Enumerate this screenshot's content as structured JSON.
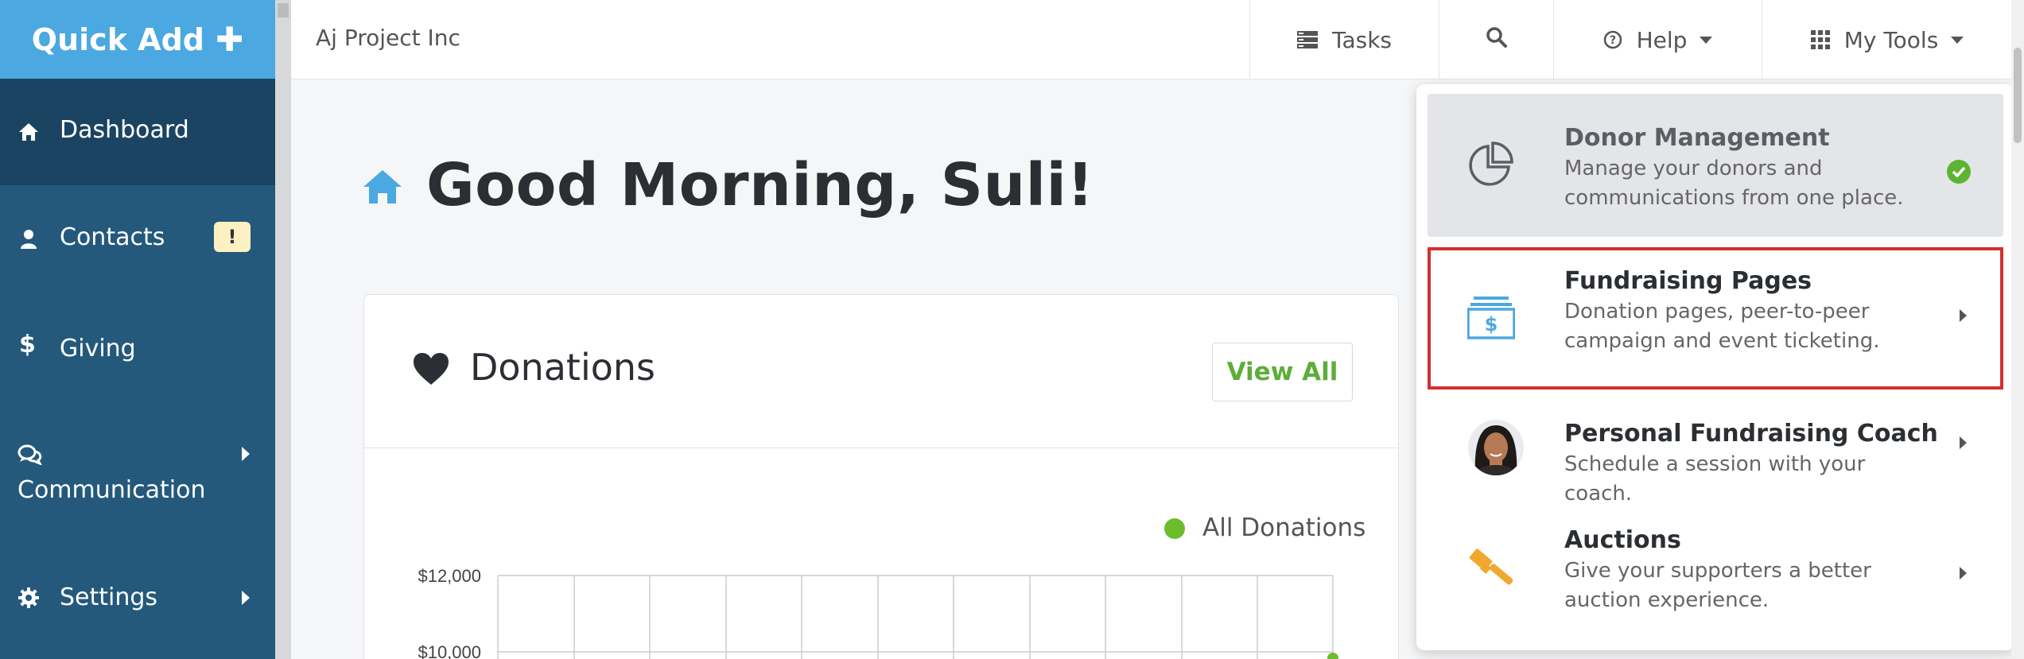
{
  "sidebar": {
    "quick_add": "Quick Add",
    "items": [
      {
        "label": "Dashboard",
        "icon": "home-icon"
      },
      {
        "label": "Contacts",
        "icon": "user-icon",
        "badge": "!"
      },
      {
        "label": "Giving",
        "icon": "dollar-icon"
      },
      {
        "label": "Communication",
        "icon": "chat-icon"
      },
      {
        "label": "Settings",
        "icon": "gear-icon"
      }
    ]
  },
  "topbar": {
    "org_name": "Aj Project Inc",
    "tasks_label": "Tasks",
    "help_label": "Help",
    "tools_label": "My Tools"
  },
  "main": {
    "greeting": "Good Morning, Suli!",
    "donations_card": {
      "title": "Donations",
      "view_all_label": "View All",
      "legend_label": "All Donations",
      "y_ticks": [
        "$12,000",
        "$10,000"
      ]
    }
  },
  "tools_menu": {
    "items": [
      {
        "title": "Donor Management",
        "desc": "Manage your donors and communications from one place.",
        "icon": "pie-chart-icon",
        "active": true
      },
      {
        "title": "Fundraising Pages",
        "desc": "Donation pages, peer-to-peer campaign and event ticketing.",
        "icon": "money-stack-icon",
        "highlighted": true
      },
      {
        "title": "Personal Fundraising Coach",
        "desc": "Schedule a session with your coach.",
        "icon": "coach-avatar"
      },
      {
        "title": "Auctions",
        "desc": "Give your supporters a better auction experience.",
        "icon": "gavel-icon"
      }
    ]
  },
  "colors": {
    "sidebar": "#24597c",
    "sidebar_active": "#1b4462",
    "quick_add": "#4ba8e0",
    "accent_green": "#5cae38",
    "highlight_red": "#d32f2f"
  }
}
